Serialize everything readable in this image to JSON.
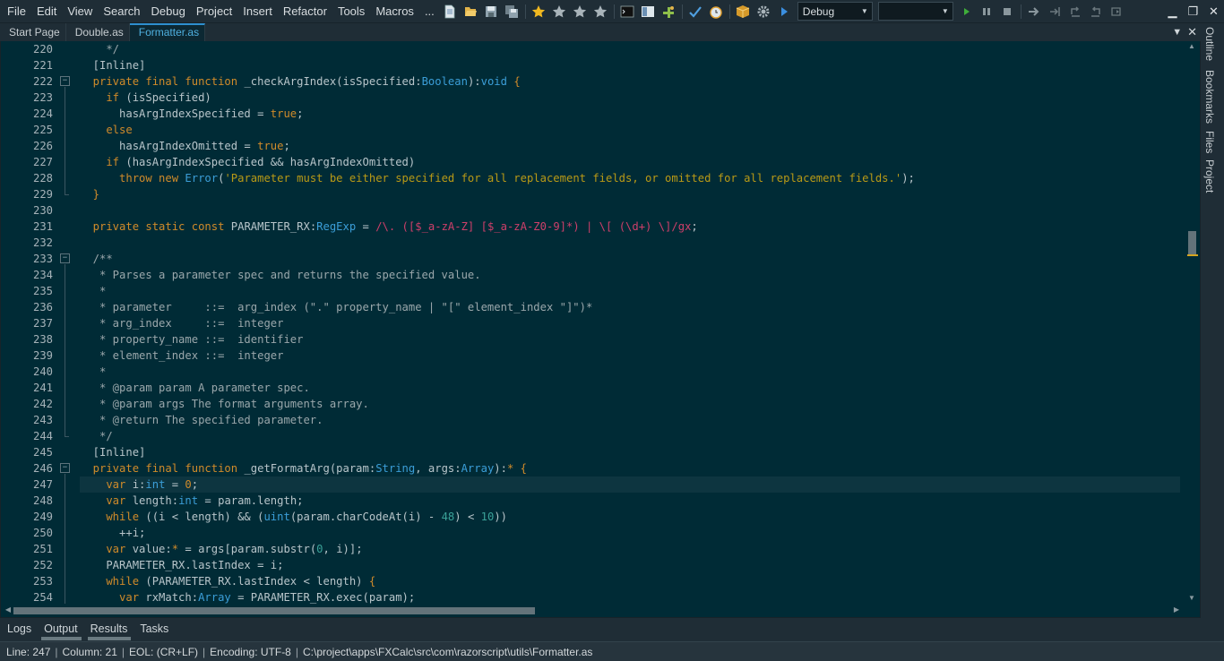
{
  "menu": [
    "File",
    "Edit",
    "View",
    "Search",
    "Debug",
    "Project",
    "Insert",
    "Refactor",
    "Tools",
    "Macros",
    "..."
  ],
  "toolbar": {
    "configuration": "Debug",
    "target": "",
    "icons": [
      "new-file-icon",
      "open-file-icon",
      "save-icon",
      "save-all-icon",
      "bookmark-star-icon",
      "bookmark-prev-icon",
      "bookmark-next-icon",
      "bookmark-clear-icon",
      "command-prompt-icon",
      "layout-icon",
      "plugin-icon",
      "check-syntax-icon",
      "clock-icon",
      "package-icon",
      "settings-gear-icon",
      "run-icon",
      "play-icon",
      "pause-icon",
      "stop-icon",
      "step-over-icon",
      "step-into-icon",
      "step-out-icon",
      "restart-icon",
      "continue-icon"
    ]
  },
  "tabs": [
    {
      "label": "Start Page",
      "active": false
    },
    {
      "label": "Double.as",
      "active": false
    },
    {
      "label": "Formatter.as",
      "active": true
    }
  ],
  "dock_tabs": [
    "Outline",
    "Bookmarks",
    "Files",
    "Project"
  ],
  "editor": {
    "current_line": 247,
    "lines": [
      {
        "n": 220,
        "fold": false,
        "tokens": [
          [
            "cmt",
            "    */"
          ]
        ]
      },
      {
        "n": 221,
        "fold": false,
        "tokens": [
          [
            "pl",
            "  [Inline]"
          ]
        ]
      },
      {
        "n": 222,
        "fold": true,
        "tokens": [
          [
            "kw",
            "  private final function "
          ],
          [
            "pl",
            "_checkArgIndex(isSpecified:"
          ],
          [
            "ty",
            "Boolean"
          ],
          [
            "pl",
            "):"
          ],
          [
            "ty",
            "void"
          ],
          [
            "kw",
            " {"
          ]
        ]
      },
      {
        "n": 223,
        "fold": false,
        "tokens": [
          [
            "kw",
            "    if "
          ],
          [
            "pl",
            "(isSpecified)"
          ]
        ]
      },
      {
        "n": 224,
        "fold": false,
        "tokens": [
          [
            "pl",
            "      hasArgIndexSpecified = "
          ],
          [
            "kw",
            "true"
          ],
          [
            "pl",
            ";"
          ]
        ]
      },
      {
        "n": 225,
        "fold": false,
        "tokens": [
          [
            "kw",
            "    else"
          ]
        ]
      },
      {
        "n": 226,
        "fold": false,
        "tokens": [
          [
            "pl",
            "      hasArgIndexOmitted = "
          ],
          [
            "kw",
            "true"
          ],
          [
            "pl",
            ";"
          ]
        ]
      },
      {
        "n": 227,
        "fold": false,
        "tokens": [
          [
            "kw",
            "    if "
          ],
          [
            "pl",
            "(hasArgIndexSpecified && hasArgIndexOmitted)"
          ]
        ]
      },
      {
        "n": 228,
        "fold": false,
        "tokens": [
          [
            "kw",
            "      throw new "
          ],
          [
            "ty",
            "Error"
          ],
          [
            "pl",
            "("
          ],
          [
            "st",
            "'Parameter must be either specified for all replacement fields, or omitted for all replacement fields.'"
          ],
          [
            "pl",
            ");"
          ]
        ]
      },
      {
        "n": 229,
        "fold": false,
        "tokens": [
          [
            "kw",
            "  }"
          ]
        ]
      },
      {
        "n": 230,
        "fold": false,
        "tokens": [
          [
            "pl",
            ""
          ]
        ]
      },
      {
        "n": 231,
        "fold": false,
        "tokens": [
          [
            "kw",
            "  private static const "
          ],
          [
            "pl",
            "PARAMETER_RX:"
          ],
          [
            "ty",
            "RegExp"
          ],
          [
            "pl",
            " = "
          ],
          [
            "rx",
            "/\\. ([$_a-zA-Z] [$_a-zA-Z0-9]*) | \\[ (\\d+) \\]/gx"
          ],
          [
            "pl",
            ";"
          ]
        ]
      },
      {
        "n": 232,
        "fold": false,
        "tokens": [
          [
            "pl",
            ""
          ]
        ]
      },
      {
        "n": 233,
        "fold": true,
        "tokens": [
          [
            "cmt",
            "  /**"
          ]
        ]
      },
      {
        "n": 234,
        "fold": false,
        "tokens": [
          [
            "cmt",
            "   * Parses a parameter spec and returns the specified value."
          ]
        ]
      },
      {
        "n": 235,
        "fold": false,
        "tokens": [
          [
            "cmt",
            "   *"
          ]
        ]
      },
      {
        "n": 236,
        "fold": false,
        "tokens": [
          [
            "cmt",
            "   * parameter     ::=  arg_index (\".\" property_name | \"[\" element_index \"]\")*"
          ]
        ]
      },
      {
        "n": 237,
        "fold": false,
        "tokens": [
          [
            "cmt",
            "   * arg_index     ::=  integer"
          ]
        ]
      },
      {
        "n": 238,
        "fold": false,
        "tokens": [
          [
            "cmt",
            "   * property_name ::=  identifier"
          ]
        ]
      },
      {
        "n": 239,
        "fold": false,
        "tokens": [
          [
            "cmt",
            "   * element_index ::=  integer"
          ]
        ]
      },
      {
        "n": 240,
        "fold": false,
        "tokens": [
          [
            "cmt",
            "   *"
          ]
        ]
      },
      {
        "n": 241,
        "fold": false,
        "tokens": [
          [
            "cmt",
            "   * @param param A parameter spec."
          ]
        ]
      },
      {
        "n": 242,
        "fold": false,
        "tokens": [
          [
            "cmt",
            "   * @param args The format arguments array."
          ]
        ]
      },
      {
        "n": 243,
        "fold": false,
        "tokens": [
          [
            "cmt",
            "   * @return The specified parameter."
          ]
        ]
      },
      {
        "n": 244,
        "fold": false,
        "tokens": [
          [
            "cmt",
            "   */"
          ]
        ]
      },
      {
        "n": 245,
        "fold": false,
        "tokens": [
          [
            "pl",
            "  [Inline]"
          ]
        ]
      },
      {
        "n": 246,
        "fold": true,
        "tokens": [
          [
            "kw",
            "  private final function "
          ],
          [
            "pl",
            "_getFormatArg(param:"
          ],
          [
            "ty",
            "String"
          ],
          [
            "pl",
            ", args:"
          ],
          [
            "ty",
            "Array"
          ],
          [
            "pl",
            "):"
          ],
          [
            "kw",
            "* {"
          ]
        ]
      },
      {
        "n": 247,
        "fold": false,
        "tokens": [
          [
            "kw",
            "    var "
          ],
          [
            "pl",
            "i:"
          ],
          [
            "ty",
            "int"
          ],
          [
            "pl",
            " = "
          ],
          [
            "kw",
            "0"
          ],
          [
            "pl",
            ";"
          ]
        ]
      },
      {
        "n": 248,
        "fold": false,
        "tokens": [
          [
            "kw",
            "    var "
          ],
          [
            "pl",
            "length:"
          ],
          [
            "ty",
            "int"
          ],
          [
            "pl",
            " = param.length;"
          ]
        ]
      },
      {
        "n": 249,
        "fold": false,
        "tokens": [
          [
            "kw",
            "    while "
          ],
          [
            "pl",
            "((i < length) && ("
          ],
          [
            "ty",
            "uint"
          ],
          [
            "pl",
            "(param.charCodeAt(i) - "
          ],
          [
            "nm",
            "48"
          ],
          [
            "pl",
            ") < "
          ],
          [
            "nm",
            "10"
          ],
          [
            "pl",
            "))"
          ]
        ]
      },
      {
        "n": 250,
        "fold": false,
        "tokens": [
          [
            "pl",
            "      ++i;"
          ]
        ]
      },
      {
        "n": 251,
        "fold": false,
        "tokens": [
          [
            "kw",
            "    var "
          ],
          [
            "pl",
            "value:"
          ],
          [
            "kw",
            "*"
          ],
          [
            "pl",
            " = args[param.substr("
          ],
          [
            "nm",
            "0"
          ],
          [
            "pl",
            ", i)];"
          ]
        ]
      },
      {
        "n": 252,
        "fold": false,
        "tokens": [
          [
            "pl",
            "    PARAMETER_RX.lastIndex = i;"
          ]
        ]
      },
      {
        "n": 253,
        "fold": false,
        "tokens": [
          [
            "kw",
            "    while "
          ],
          [
            "pl",
            "(PARAMETER_RX.lastIndex < length) "
          ],
          [
            "kw",
            "{"
          ]
        ]
      },
      {
        "n": 254,
        "fold": false,
        "tokens": [
          [
            "kw",
            "      var "
          ],
          [
            "pl",
            "rxMatch:"
          ],
          [
            "ty",
            "Array"
          ],
          [
            "pl",
            " = PARAMETER_RX.exec(param);"
          ]
        ]
      }
    ]
  },
  "panel_tabs": [
    "Logs",
    "Output",
    "Results",
    "Tasks"
  ],
  "status": {
    "line": "Line: 247",
    "column": "Column: 21",
    "eol": "EOL: (CR+LF)",
    "encoding": "Encoding: UTF-8",
    "path": "C:\\project\\apps\\FXCalc\\src\\com\\razorscript\\utils\\Formatter.as"
  }
}
